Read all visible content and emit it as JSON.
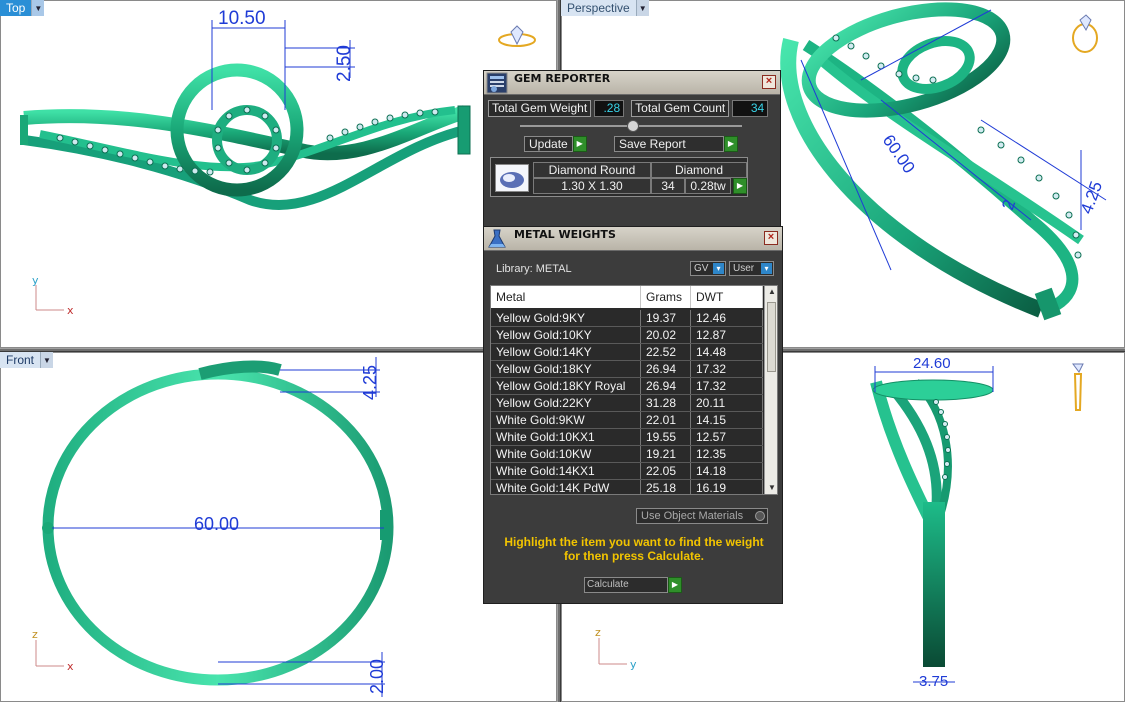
{
  "viewports": {
    "top": {
      "label": "Top",
      "dims": [
        "10.50",
        "2.50"
      ],
      "axes": [
        "y",
        "x"
      ]
    },
    "perspective": {
      "label": "Perspective",
      "dims": [
        "60.00",
        "4.25",
        "2"
      ]
    },
    "front": {
      "label": "Front",
      "dims": [
        "4.25",
        "60.00",
        "2.00"
      ],
      "axes": [
        "z",
        "x"
      ]
    },
    "right": {
      "dims": [
        "24.60",
        "3.75"
      ],
      "axes": [
        "z",
        "y"
      ]
    }
  },
  "gem_reporter": {
    "title": "GEM REPORTER",
    "total_weight_label": "Total Gem Weight",
    "total_weight_value": ".28",
    "total_count_label": "Total Gem Count",
    "total_count_value": "34",
    "update_label": "Update",
    "save_report_label": "Save Report",
    "gem": {
      "shape": "Diamond Round",
      "size": "1.30 X 1.30",
      "material": "Diamond",
      "count": "34",
      "weight": "0.28tw"
    }
  },
  "metal_weights": {
    "title": "METAL WEIGHTS",
    "library_label": "Library: METAL",
    "gv_label": "GV",
    "user_label": "User",
    "columns": [
      "Metal",
      "Grams",
      "DWT"
    ],
    "rows": [
      [
        "Yellow Gold:9KY",
        "19.37",
        "12.46"
      ],
      [
        "Yellow Gold:10KY",
        "20.02",
        "12.87"
      ],
      [
        "Yellow Gold:14KY",
        "22.52",
        "14.48"
      ],
      [
        "Yellow Gold:18KY",
        "26.94",
        "17.32"
      ],
      [
        "Yellow Gold:18KY Royal",
        "26.94",
        "17.32"
      ],
      [
        "Yellow Gold:22KY",
        "31.28",
        "20.11"
      ],
      [
        "White Gold:9KW",
        "22.01",
        "14.15"
      ],
      [
        "White Gold:10KX1",
        "19.55",
        "12.57"
      ],
      [
        "White Gold:10KW",
        "19.21",
        "12.35"
      ],
      [
        "White Gold:14KX1",
        "22.05",
        "14.18"
      ],
      [
        "White Gold:14K PdW",
        "25.18",
        "16.19"
      ]
    ],
    "use_object_label": "Use Object Materials",
    "hint_line1": "Highlight the item you want to find the weight",
    "hint_line2": "for then press Calculate.",
    "calculate_label": "Calculate"
  }
}
